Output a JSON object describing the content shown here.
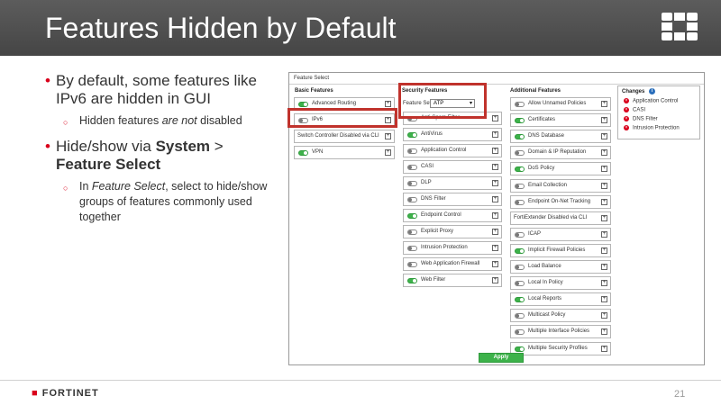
{
  "slide": {
    "title": "Features Hidden by Default",
    "page_number": "21",
    "brand": "FORTINET",
    "accent_color": "#d9001b",
    "title_bar_color": "#4f4f4f"
  },
  "bullets": {
    "b1": "By default, some features like IPv6 are hidden in GUI",
    "b1_sub_a": "Hidden features ",
    "b1_sub_b": "are not",
    "b1_sub_c": " disabled",
    "b2_a": "Hide/show via ",
    "b2_b": "System",
    "b2_c": " > ",
    "b2_d": "Feature Select",
    "b2_sub_a": "In ",
    "b2_sub_b": "Feature Select",
    "b2_sub_c": ", select to hide/show groups of features commonly used together"
  },
  "screenshot": {
    "header": "Feature Select",
    "basic": {
      "title": "Basic Features",
      "items": [
        {
          "label": "Advanced Routing",
          "on": true
        },
        {
          "label": "IPv6",
          "on": false
        },
        {
          "label": "Switch Controller Disabled via CLI",
          "on": false,
          "plain": true
        },
        {
          "label": "VPN",
          "on": true
        }
      ]
    },
    "security": {
      "title": "Security Features",
      "feature_set_label": "Feature Set:",
      "feature_set_value": "ATP",
      "items": [
        {
          "label": "Anti-Spam Filter",
          "on": false
        },
        {
          "label": "AntiVirus",
          "on": true
        },
        {
          "label": "Application Control",
          "on": false
        },
        {
          "label": "CASI",
          "on": false
        },
        {
          "label": "DLP",
          "on": false
        },
        {
          "label": "DNS Filter",
          "on": false
        },
        {
          "label": "Endpoint Control",
          "on": true
        },
        {
          "label": "Explicit Proxy",
          "on": false
        },
        {
          "label": "Intrusion Protection",
          "on": false
        },
        {
          "label": "Web Application Firewall",
          "on": false
        },
        {
          "label": "Web Filter",
          "on": true
        }
      ]
    },
    "additional": {
      "title": "Additional Features",
      "items": [
        {
          "label": "Allow Unnamed Policies",
          "on": false
        },
        {
          "label": "Certificates",
          "on": true
        },
        {
          "label": "DNS Database",
          "on": true
        },
        {
          "label": "Domain & IP Reputation",
          "on": false
        },
        {
          "label": "DoS Policy",
          "on": true
        },
        {
          "label": "Email Collection",
          "on": false
        },
        {
          "label": "Endpoint On-Net Tracking",
          "on": false
        },
        {
          "label": "FortiExtender Disabled via CLI",
          "on": false,
          "plain": true
        },
        {
          "label": "ICAP",
          "on": false
        },
        {
          "label": "Implicit Firewall Policies",
          "on": true
        },
        {
          "label": "Load Balance",
          "on": false
        },
        {
          "label": "Local In Policy",
          "on": false
        },
        {
          "label": "Local Reports",
          "on": true
        },
        {
          "label": "Multicast Policy",
          "on": false
        },
        {
          "label": "Multiple Interface Policies",
          "on": false
        },
        {
          "label": "Multiple Security Profiles",
          "on": true
        }
      ]
    },
    "changes": {
      "title": "Changes",
      "items": [
        "Application Control",
        "CASI",
        "DNS Filter",
        "Intrusion Protection"
      ]
    },
    "apply_label": "Apply"
  }
}
